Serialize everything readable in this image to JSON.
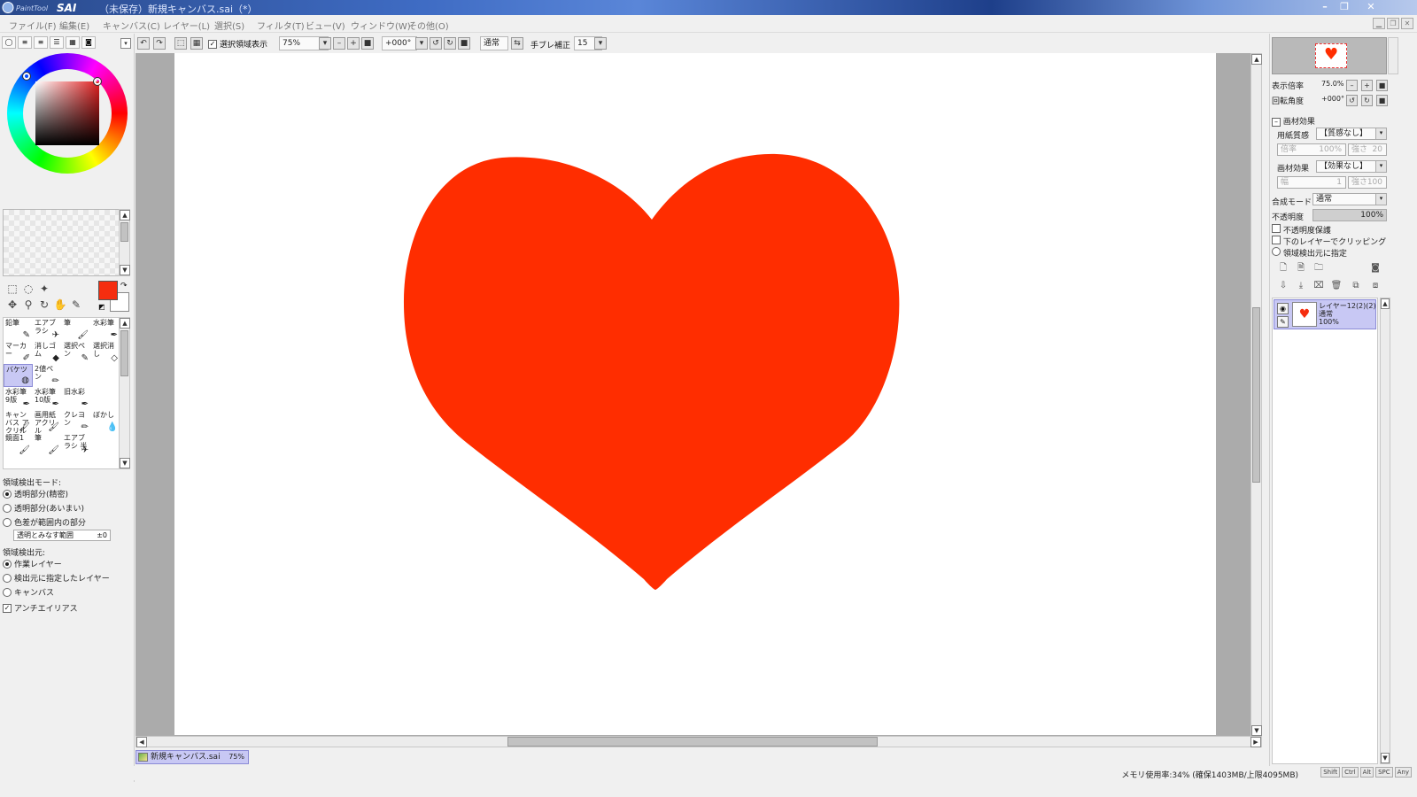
{
  "app": {
    "logo_text": "PaintTool SAI",
    "window_title": "（未保存）新規キャンバス.sai（*）",
    "window_buttons": [
      "–",
      "❐",
      "✕"
    ]
  },
  "menu": [
    "ファイル(F)",
    "編集(E)",
    "キャンバス(C)",
    "レイヤー(L)",
    "選択(S)",
    "フィルタ(T)",
    "ビュー(V)",
    "ウィンドウ(W)",
    "その他(O)"
  ],
  "toolbar": {
    "show_selection_label": "選択領域表示",
    "show_selection_checked": true,
    "zoom_value": "75%",
    "rotation_value": "+000°",
    "blend_mode": "通常",
    "stabilizer_label": "手ブレ補正",
    "stabilizer_value": "15"
  },
  "colors": {
    "foreground": "#f52d0f",
    "background": "#ffffff",
    "selection_highlight": "#c8c8f4"
  },
  "tools": [
    {
      "label": "鉛筆",
      "icon": "pencil-icon"
    },
    {
      "label": "エアブラシ",
      "icon": "airbrush-icon"
    },
    {
      "label": "筆",
      "icon": "brush-icon"
    },
    {
      "label": "水彩筆",
      "icon": "watercolor-icon"
    },
    {
      "label": "マーカー",
      "icon": "marker-icon"
    },
    {
      "label": "消しゴム",
      "icon": "eraser-icon"
    },
    {
      "label": "選択ペン",
      "icon": "select-pen-icon"
    },
    {
      "label": "選択消し",
      "icon": "select-eraser-icon"
    },
    {
      "label": "バケツ",
      "icon": "bucket-icon",
      "selected": true
    },
    {
      "label": "2値ペン",
      "icon": "binary-pen-icon"
    },
    {
      "label": "",
      "icon": ""
    },
    {
      "label": "",
      "icon": ""
    },
    {
      "label": "水彩筆 9版",
      "icon": "watercolor-icon"
    },
    {
      "label": "水彩筆 10版",
      "icon": "watercolor-icon"
    },
    {
      "label": "旧水彩",
      "icon": "watercolor-icon"
    },
    {
      "label": "",
      "icon": ""
    },
    {
      "label": "キャンバス アクリル",
      "icon": "brush-icon"
    },
    {
      "label": "画用紙 アクリル",
      "icon": "brush-icon"
    },
    {
      "label": "クレヨン",
      "icon": "crayon-icon"
    },
    {
      "label": "ぼかし",
      "icon": "blur-icon"
    },
    {
      "label": "鏡面1",
      "icon": "brush-icon"
    },
    {
      "label": "筆",
      "icon": "brush-icon"
    },
    {
      "label": "エアブラシ 半",
      "icon": "airbrush-icon"
    },
    {
      "label": "",
      "icon": ""
    }
  ],
  "fill_options": {
    "detect_mode_label": "領域検出モード:",
    "detect_modes": [
      {
        "label": "透明部分(精密)",
        "selected": true
      },
      {
        "label": "透明部分(あいまい)",
        "selected": false
      },
      {
        "label": "色差が範囲内の部分",
        "selected": false
      }
    ],
    "tolerance_label": "透明とみなす範囲",
    "tolerance_value": "±0",
    "source_label": "領域検出元:",
    "sources": [
      {
        "label": "作業レイヤー",
        "selected": true
      },
      {
        "label": "検出元に指定したレイヤー",
        "selected": false
      },
      {
        "label": "キャンバス",
        "selected": false
      }
    ],
    "antialias_label": "アンチエイリアス",
    "antialias_checked": true
  },
  "document_tab": {
    "name": "新規キャンバス.sai",
    "zoom": "75%"
  },
  "status": {
    "memory": "メモリ使用率:34% (確保1403MB/上限4095MB)",
    "keys": [
      "Shift",
      "Ctrl",
      "Alt",
      "SPC",
      "Any"
    ]
  },
  "navigator": {
    "zoom_label": "表示倍率",
    "zoom_value": "75.0%",
    "rotation_label": "回転角度",
    "rotation_value": "+000°"
  },
  "paper": {
    "section_label": "画材効果",
    "texture_label": "用紙質感",
    "texture_value": "【質感なし】",
    "scale_label": "倍率",
    "scale_value": "100%",
    "strength_label": "強さ",
    "strength_value": "20",
    "effect_label": "画材効果",
    "effect_value": "【効果なし】",
    "width_label": "幅",
    "width_value": "1",
    "effect_strength_value": "100"
  },
  "layer_props": {
    "blend_label": "合成モード",
    "blend_value": "通常",
    "opacity_label": "不透明度",
    "opacity_value": "100%",
    "preserve_opacity_label": "不透明度保護",
    "clipping_label": "下のレイヤーでクリッピング",
    "detect_source_label": "領域検出元に指定"
  },
  "layers": [
    {
      "name": "レイヤー12(2)(2)",
      "mode": "通常",
      "opacity": "100%",
      "visible": true,
      "selected": true
    }
  ],
  "canvas": {
    "shape": "heart",
    "fill_color": "#ff2d00"
  }
}
